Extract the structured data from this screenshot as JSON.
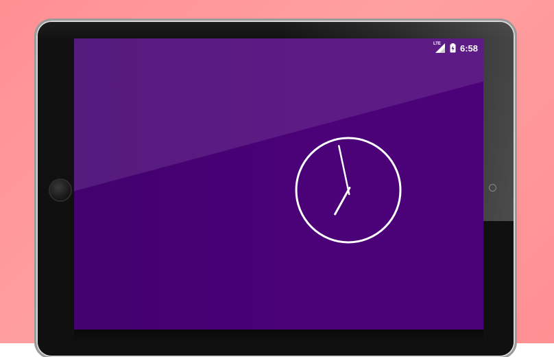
{
  "status_bar": {
    "network_label": "LTE",
    "network_icon": "lte-signal-icon",
    "battery_icon": "battery-charging-icon",
    "time": "6:58"
  },
  "clock": {
    "type": "analog",
    "hour": 6,
    "minute": 58,
    "face_color": "#ffffff"
  },
  "colors": {
    "background": "#ff8f92",
    "screen": "#4b0178",
    "device_bezel": "#111111"
  }
}
